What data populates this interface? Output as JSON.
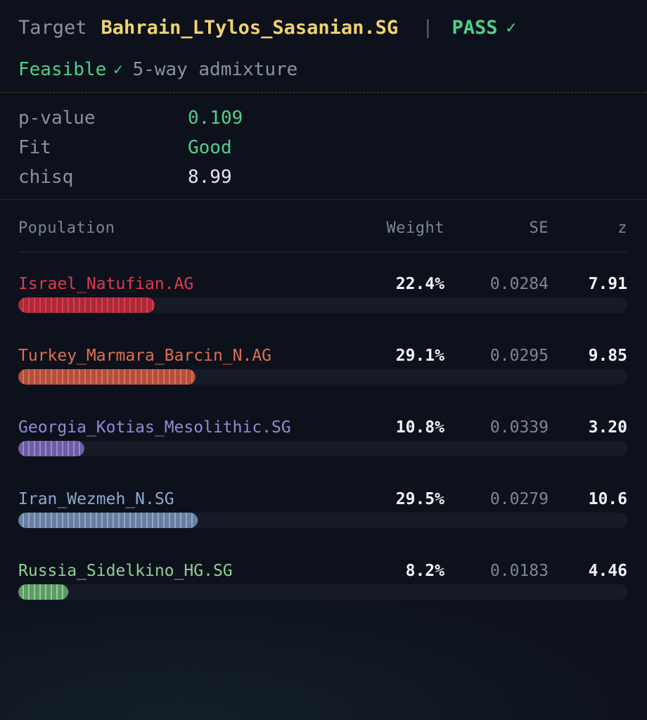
{
  "header": {
    "target_label": "Target",
    "target_name": "Bahrain_LTylos_Sasanian.SG",
    "separator": "|",
    "status": "PASS",
    "status_check": "✓",
    "feasible": "Feasible",
    "feasible_check": "✓",
    "model": "5-way admixture"
  },
  "stats": [
    {
      "label": "p-value",
      "value": "0.109"
    },
    {
      "label": "Fit",
      "value": "Good"
    },
    {
      "label": "chisq",
      "value": "8.99"
    }
  ],
  "table": {
    "headers": {
      "population": "Population",
      "weight": "Weight",
      "se": "SE",
      "z": "z"
    },
    "rows": [
      {
        "name": "Israel_Natufian.AG",
        "weight": "22.4%",
        "fraction": 0.224,
        "se": "0.0284",
        "z": "7.91",
        "color": "#e03a4c",
        "bar": "#a92b3a"
      },
      {
        "name": "Turkey_Marmara_Barcin_N.AG",
        "weight": "29.1%",
        "fraction": 0.291,
        "se": "0.0295",
        "z": "9.85",
        "color": "#e06e52",
        "bar": "#b0513f"
      },
      {
        "name": "Georgia_Kotias_Mesolithic.SG",
        "weight": "10.8%",
        "fraction": 0.108,
        "se": "0.0339",
        "z": "3.20",
        "color": "#9a86d8",
        "bar": "#6c5ea0"
      },
      {
        "name": "Iran_Wezmeh_N.SG",
        "weight": "29.5%",
        "fraction": 0.295,
        "se": "0.0279",
        "z": "10.6",
        "color": "#8ea8d0",
        "bar": "#6a7f9e"
      },
      {
        "name": "Russia_Sidelkino_HG.SG",
        "weight": "8.2%",
        "fraction": 0.082,
        "se": "0.0183",
        "z": "4.46",
        "color": "#8fcf92",
        "bar": "#5f9a66"
      }
    ]
  }
}
